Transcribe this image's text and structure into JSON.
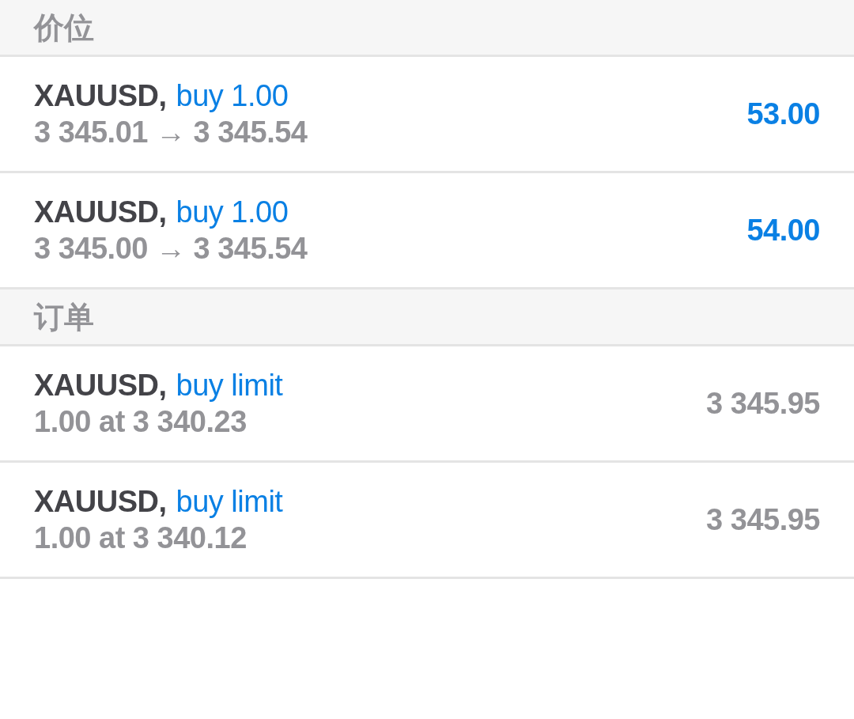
{
  "sections": [
    {
      "title": "价位",
      "items": [
        {
          "kind": "position",
          "symbol": "XAUUSD,",
          "trade": "buy 1.00",
          "prices": "3 345.01 → 3 345.54",
          "profit": "53.00"
        },
        {
          "kind": "position",
          "symbol": "XAUUSD,",
          "trade": "buy 1.00",
          "prices": "3 345.00 → 3 345.54",
          "profit": "54.00"
        }
      ]
    },
    {
      "title": "订单",
      "items": [
        {
          "kind": "order",
          "symbol": "XAUUSD,",
          "trade": "buy limit",
          "details": "1.00 at 3 340.23",
          "price": "3 345.95"
        },
        {
          "kind": "order",
          "symbol": "XAUUSD,",
          "trade": "buy limit",
          "details": "1.00 at 3 340.12",
          "price": "3 345.95"
        }
      ]
    }
  ]
}
